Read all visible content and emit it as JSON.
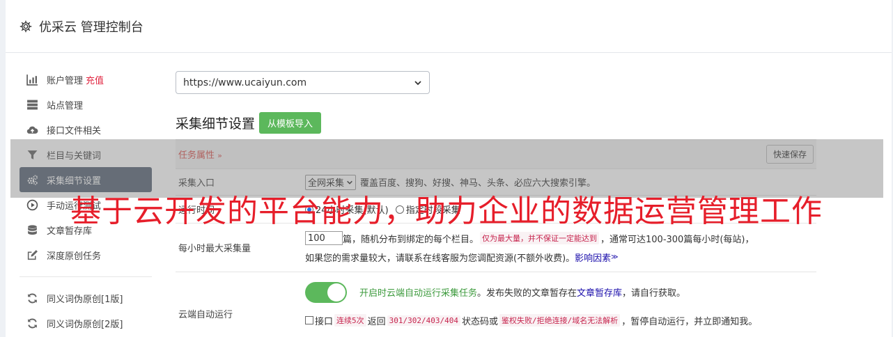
{
  "header": {
    "title": "优采云 管理控制台",
    "icon": "gear-icon"
  },
  "sidebar": {
    "items": [
      {
        "label": "账户管理",
        "accent": "充值",
        "icon": "bar-chart-icon"
      },
      {
        "label": "站点管理",
        "icon": "server-icon"
      },
      {
        "label": "接口文件相关",
        "icon": "cloud-upload-icon"
      },
      {
        "label": "栏目与关键词",
        "icon": "filter-icon"
      },
      {
        "label": "采集细节设置",
        "icon": "cogs-icon",
        "active": true
      },
      {
        "label": "手动运行测试",
        "icon": "play-icon"
      },
      {
        "label": "文章暂存库",
        "icon": "database-icon"
      },
      {
        "label": "深度原创任务",
        "icon": "edit-icon"
      }
    ],
    "extra_items": [
      {
        "label": "同义词伪原创[1版]",
        "icon": "refresh-icon"
      },
      {
        "label": "同义词伪原创[2版]",
        "icon": "refresh-icon"
      }
    ]
  },
  "main": {
    "site_select": {
      "value": "https://www.ucaiyun.com"
    },
    "section_title": "采集细节设置",
    "import_button": "从模板导入",
    "task_props": {
      "label": "任务属性",
      "chevron": "»",
      "save_button": "快速保存"
    },
    "collect_entry": {
      "label": "采集入口",
      "select_value": "全网采集",
      "desc": "覆盖百度、搜狗、好搜、神马、头条、必应六大搜索引擎。"
    },
    "run_time": {
      "label": "运行时间",
      "option1": "24小时采集(默认)",
      "option2": "指定时段采集"
    },
    "max_per_hour": {
      "label": "每小时最大采集量",
      "value": "100",
      "text1": "篇，随机分布到绑定的每个栏目。",
      "code1": "仅为最大量，并不保证一定能达到",
      "text2": "，通常可达100-300篇每小时(每站)，",
      "text3": "如果您的需求量较大，请联系在线客服为您调配资源(不额外收费)。",
      "link": "影响因素",
      "link_suffix": "≫"
    },
    "cloud_run": {
      "label": "云端自动运行",
      "green_text": "开启时云端自动运行采集任务",
      "text1": "。发布失败的文章暂存在",
      "link": "文章暂存库",
      "text2": "，请自行获取。",
      "cb_label": "接口",
      "code1": "连续5次",
      "text3": "返回",
      "code2": "301/302/403/404",
      "text4": "状态码或",
      "code3": "鉴权失败/拒绝连接/域名无法解析",
      "text5": "，暂停自动运行，并立即通知我。"
    }
  },
  "banner": {
    "text": "基于云开发的平台能力，助力企业的数据运营管理工作"
  }
}
